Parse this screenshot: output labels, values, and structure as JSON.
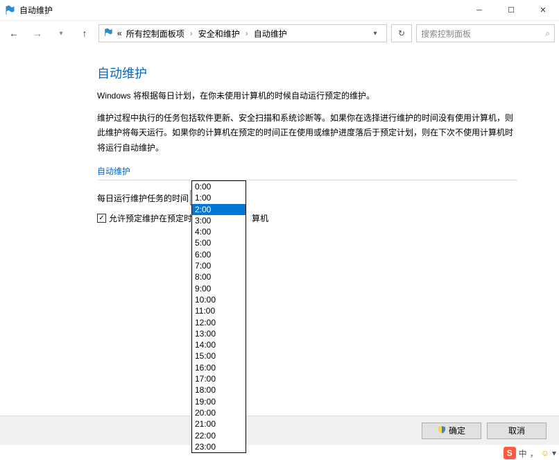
{
  "window": {
    "title": "自动维护",
    "minimize_tip": "最小化",
    "maximize_tip": "最大化",
    "close_tip": "关闭"
  },
  "breadcrumb": {
    "prefix": "«",
    "items": [
      "所有控制面板项",
      "安全和维护",
      "自动维护"
    ]
  },
  "search": {
    "placeholder": "搜索控制面板"
  },
  "page": {
    "heading": "自动维护",
    "intro": "Windows 将根据每日计划，在你未使用计算机的时候自动运行预定的维护。",
    "detail": "维护过程中执行的任务包括软件更新、安全扫描和系统诊断等。如果你在选择进行维护的时间没有使用计算机，则此维护将每天运行。如果你的计算机在预定的时间正在使用或维护进度落后于预定计划，则在下次不使用计算机时将运行自动维护。",
    "section_label": "自动维护",
    "time_label": "每日运行维护任务的时间",
    "selected_time": "2:00",
    "checkbox_label_left": "允许预定维护在预定时",
    "checkbox_label_right": "算机",
    "checkbox_checked": "✓"
  },
  "dropdown": {
    "options": [
      "0:00",
      "1:00",
      "2:00",
      "3:00",
      "4:00",
      "5:00",
      "6:00",
      "7:00",
      "8:00",
      "9:00",
      "10:00",
      "11:00",
      "12:00",
      "13:00",
      "14:00",
      "15:00",
      "16:00",
      "17:00",
      "18:00",
      "19:00",
      "20:00",
      "21:00",
      "22:00",
      "23:00"
    ],
    "selected_index": 2
  },
  "footer": {
    "ok": "确定",
    "cancel": "取消"
  },
  "ime": {
    "logo": "S",
    "mode": "中",
    "punct": "，",
    "face": "☺",
    "more": "▾"
  }
}
